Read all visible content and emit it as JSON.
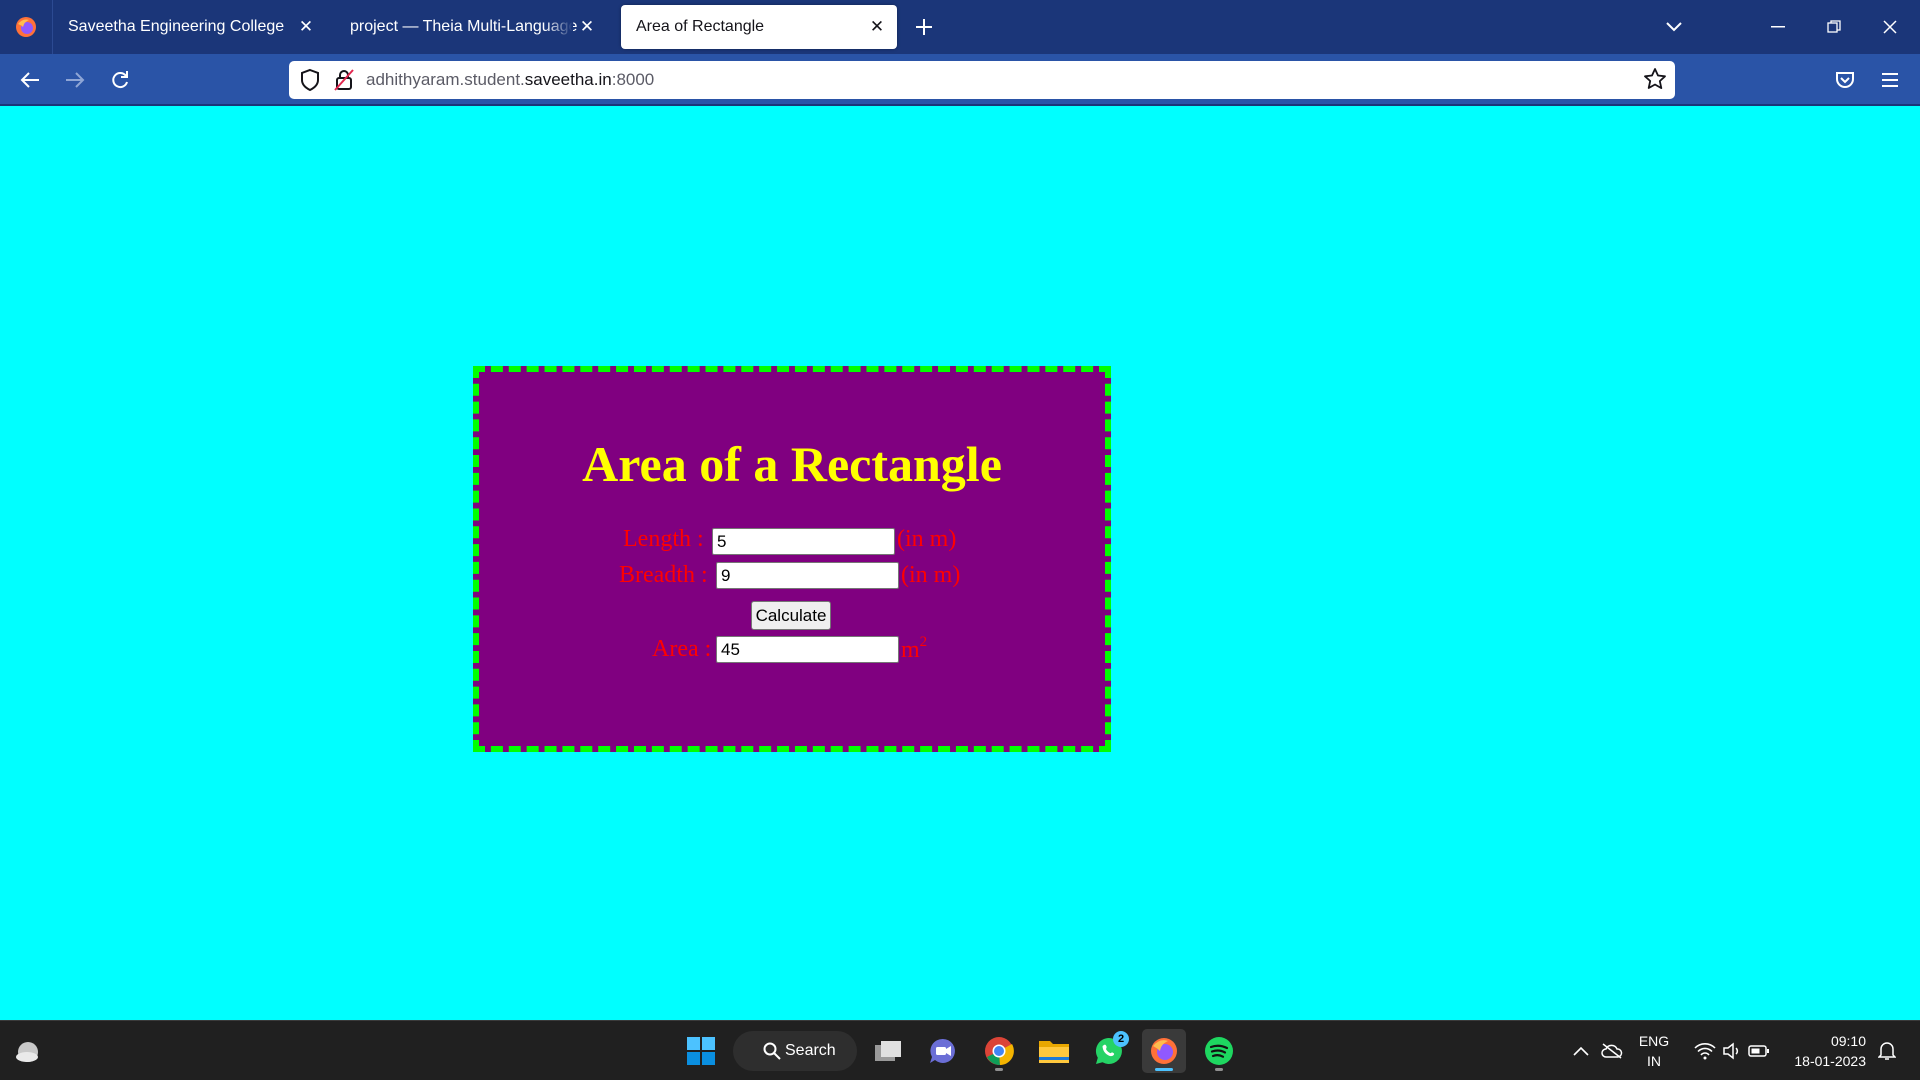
{
  "browser": {
    "tabs": [
      {
        "title": "Saveetha Engineering College",
        "active": false
      },
      {
        "title": "project — Theia Multi-Language Ex",
        "active": false
      },
      {
        "title": "Area of Rectangle",
        "active": true
      }
    ],
    "url": {
      "subdomain": "adhithyaram.student.",
      "domain": "saveetha.in",
      "port": ":8000"
    }
  },
  "page": {
    "heading": "Area of a Rectangle",
    "length": {
      "label": "Length :",
      "value": "5",
      "unit": "(in m)"
    },
    "breadth": {
      "label": "Breadth :",
      "value": "9",
      "unit": "(in m)"
    },
    "calculate_label": "Calculate",
    "area": {
      "label": "Area :",
      "value": "45",
      "unit": "m",
      "unit_exp": "2"
    },
    "colors": {
      "background": "#00ffff",
      "card": "#800080",
      "border": "#00ff00",
      "heading": "#ffff00",
      "labels": "#ff0000"
    }
  },
  "taskbar": {
    "search_label": "Search",
    "whatsapp_badge": "2",
    "lang_line1": "ENG",
    "lang_line2": "IN",
    "time": "09:10",
    "date": "18-01-2023"
  }
}
